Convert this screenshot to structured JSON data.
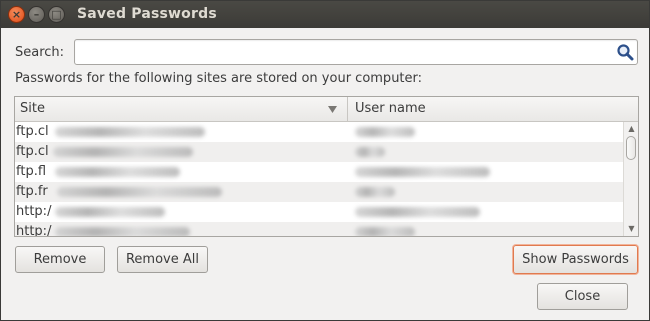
{
  "window": {
    "title": "Saved Passwords",
    "controls": {
      "close": "×",
      "minimize": "–",
      "maximize": "□"
    }
  },
  "search": {
    "label": "Search:",
    "value": "",
    "placeholder": "",
    "icon": "magnifier-icon"
  },
  "info_text": "Passwords for the following sites are stored on your computer:",
  "table": {
    "columns": [
      "Site",
      "User name"
    ],
    "rows": [
      {
        "site": "ftp.cl",
        "user": ""
      },
      {
        "site": "ftp.cl",
        "user": ""
      },
      {
        "site": "ftp.fl",
        "user": ""
      },
      {
        "site": "ftp.fr",
        "user": ""
      },
      {
        "site": "http:/",
        "user": ""
      },
      {
        "site": "http:/",
        "user": ""
      }
    ]
  },
  "buttons": {
    "remove": "Remove",
    "remove_all": "Remove All",
    "show_passwords": "Show Passwords",
    "close": "Close"
  },
  "colors": {
    "focus_accent": "#e07a4f",
    "titlebar": "#3c3b37",
    "close_button": "#df4a16"
  }
}
